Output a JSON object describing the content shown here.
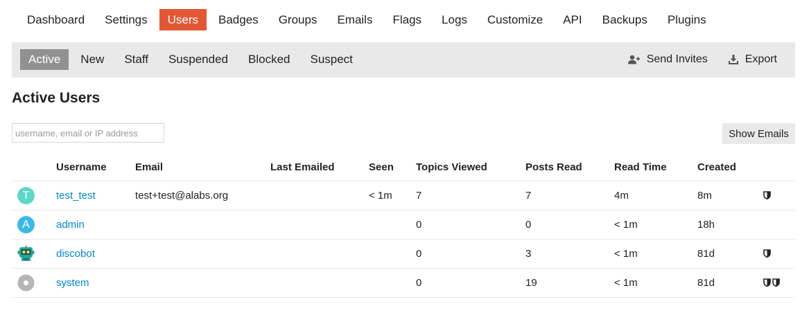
{
  "top_nav": {
    "items": [
      {
        "label": "Dashboard",
        "active": false
      },
      {
        "label": "Settings",
        "active": false
      },
      {
        "label": "Users",
        "active": true
      },
      {
        "label": "Badges",
        "active": false
      },
      {
        "label": "Groups",
        "active": false
      },
      {
        "label": "Emails",
        "active": false
      },
      {
        "label": "Flags",
        "active": false
      },
      {
        "label": "Logs",
        "active": false
      },
      {
        "label": "Customize",
        "active": false
      },
      {
        "label": "API",
        "active": false
      },
      {
        "label": "Backups",
        "active": false
      },
      {
        "label": "Plugins",
        "active": false
      }
    ]
  },
  "sub_nav": {
    "tabs": [
      {
        "label": "Active",
        "active": true
      },
      {
        "label": "New",
        "active": false
      },
      {
        "label": "Staff",
        "active": false
      },
      {
        "label": "Suspended",
        "active": false
      },
      {
        "label": "Blocked",
        "active": false
      },
      {
        "label": "Suspect",
        "active": false
      }
    ],
    "send_invites_label": "Send Invites",
    "send_invites_icon": "user-plus-icon",
    "export_label": "Export",
    "export_icon": "download-icon"
  },
  "page": {
    "title": "Active Users",
    "search_placeholder": "username, email or IP address",
    "search_value": "",
    "show_emails_label": "Show Emails"
  },
  "table": {
    "headers": {
      "username": "Username",
      "email": "Email",
      "last_emailed": "Last Emailed",
      "seen": "Seen",
      "topics_viewed": "Topics Viewed",
      "posts_read": "Posts Read",
      "read_time": "Read Time",
      "created": "Created"
    },
    "rows": [
      {
        "avatar_type": "letter",
        "avatar_letter": "T",
        "avatar_color": "#5ed8c6",
        "username": "test_test",
        "email": "test+test@alabs.org",
        "last_emailed": "",
        "seen": "< 1m",
        "topics_viewed": "7",
        "posts_read": "7",
        "read_time": "4m",
        "created": "8m",
        "shields": 1
      },
      {
        "avatar_type": "letter",
        "avatar_letter": "A",
        "avatar_color": "#3ab9e8",
        "username": "admin",
        "email": "",
        "last_emailed": "",
        "seen": "",
        "topics_viewed": "0",
        "posts_read": "0",
        "read_time": "< 1m",
        "created": "18h",
        "shields": 0
      },
      {
        "avatar_type": "robot",
        "avatar_letter": "",
        "avatar_color": "#26a59a",
        "username": "discobot",
        "email": "",
        "last_emailed": "",
        "seen": "",
        "topics_viewed": "0",
        "posts_read": "3",
        "read_time": "< 1m",
        "created": "81d",
        "shields": 1
      },
      {
        "avatar_type": "gear",
        "avatar_letter": "",
        "avatar_color": "#b5b5b5",
        "username": "system",
        "email": "",
        "last_emailed": "",
        "seen": "",
        "topics_viewed": "0",
        "posts_read": "19",
        "read_time": "< 1m",
        "created": "81d",
        "shields": 2
      }
    ]
  },
  "colors": {
    "accent": "#e45735",
    "link": "#0088cc",
    "active_tab": "#919191",
    "bar_bg": "#e9e9e9"
  }
}
